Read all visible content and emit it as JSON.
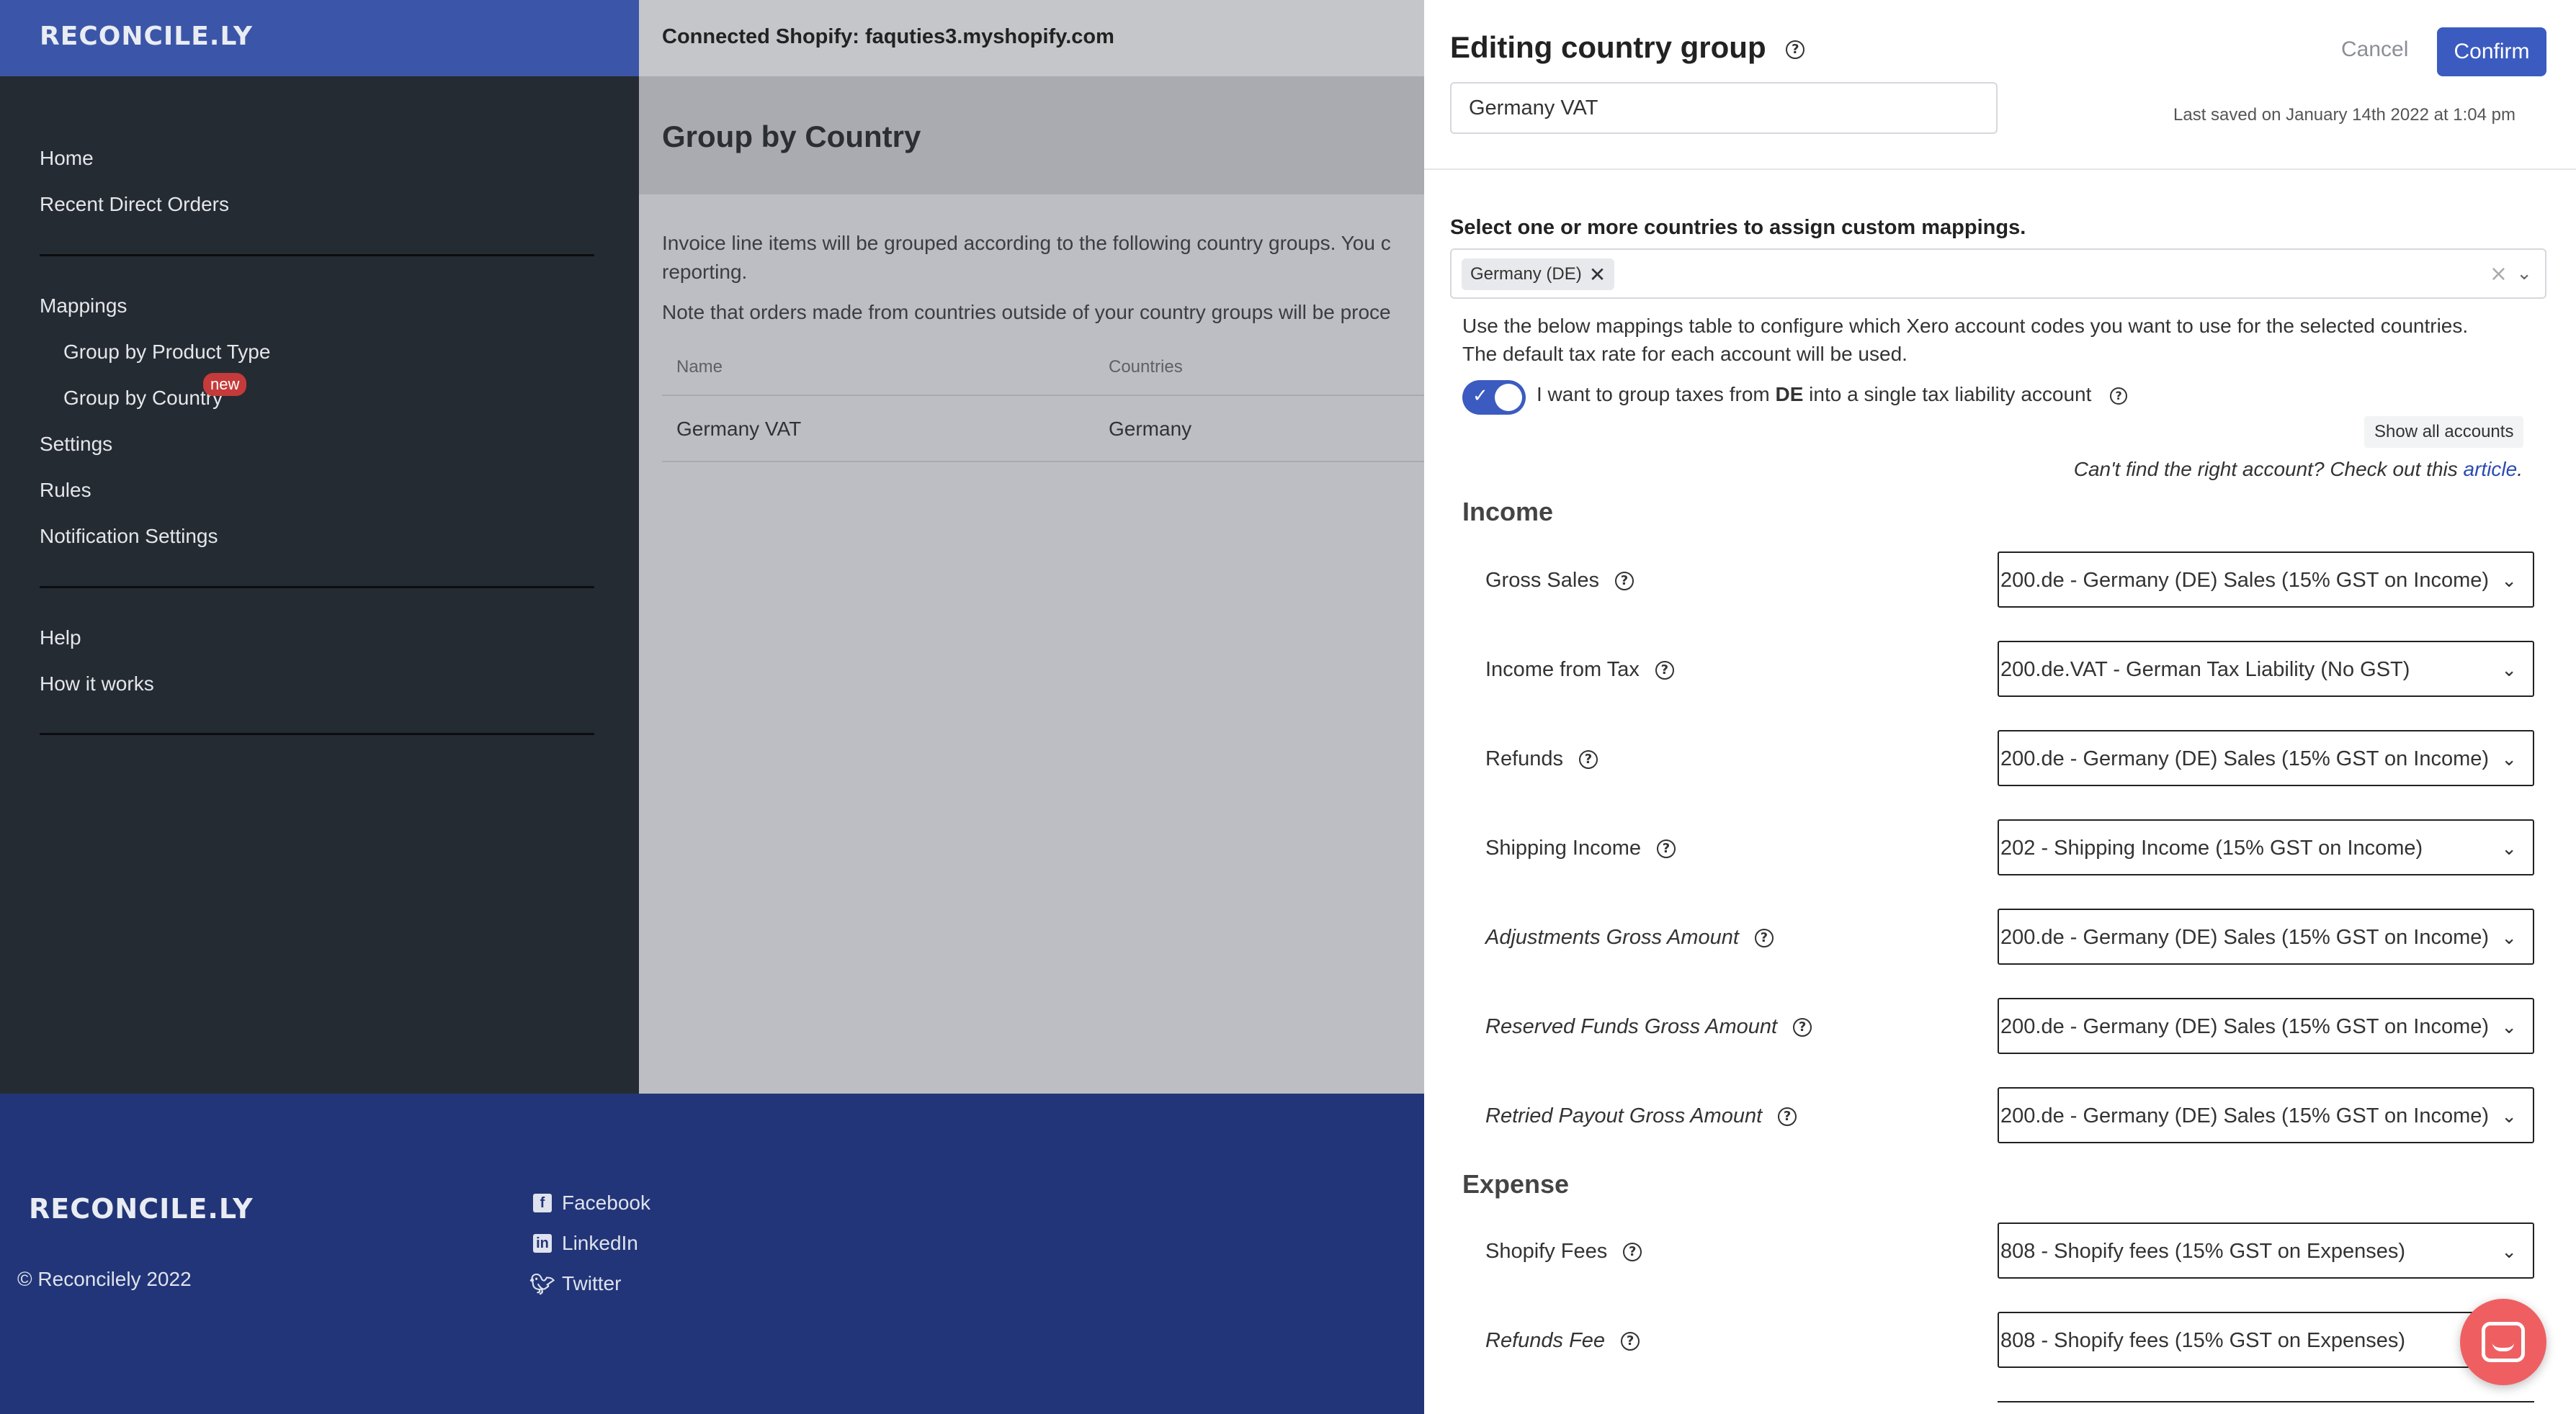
{
  "app": {
    "brand": "RECONCILE.LY"
  },
  "sidebar": {
    "items": [
      {
        "label": "Home"
      },
      {
        "label": "Recent Direct Orders"
      },
      {
        "label": "Mappings"
      },
      {
        "label": "Group by Product Type"
      },
      {
        "label": "Group by Country",
        "badge": "new"
      },
      {
        "label": "Settings"
      },
      {
        "label": "Rules"
      },
      {
        "label": "Notification Settings"
      },
      {
        "label": "Help"
      },
      {
        "label": "How it works"
      }
    ]
  },
  "main": {
    "connected": "Connected Shopify: faquties3.myshopify.com",
    "title": "Group by Country",
    "para1_line1": "Invoice line items will be grouped according to the following country groups. You c",
    "para1_line2": "reporting.",
    "para2": "Note that orders made from countries outside of your country groups will be proce",
    "table": {
      "headers": [
        "Name",
        "Countries"
      ],
      "rows": [
        [
          "Germany VAT",
          "Germany"
        ]
      ]
    }
  },
  "footer": {
    "brand": "RECONCILE.LY",
    "copyright": "© Reconcilely 2022",
    "links": [
      "Facebook",
      "LinkedIn",
      "Twitter"
    ]
  },
  "panel": {
    "title": "Editing country group",
    "cancel": "Cancel",
    "confirm": "Confirm",
    "name_value": "Germany VAT",
    "last_saved": "Last saved on January 14th 2022 at 1:04 pm",
    "select_label": "Select one or more countries to assign custom mappings.",
    "chip": "Germany (DE)",
    "desc_line1": "Use the below mappings table to configure which Xero account codes you want to use for the selected countries.",
    "desc_line2": "The default tax rate for each account will be used.",
    "toggle_pre": "I want to group taxes from ",
    "toggle_bold": "DE",
    "toggle_post": " into a single tax liability account",
    "toggle_on": true,
    "show_all": "Show all accounts",
    "help_text": "Can't find the right account? Check out this ",
    "help_link": "article",
    "help_end": ".",
    "income": {
      "heading": "Income",
      "rows": [
        {
          "label": "Gross Sales",
          "value": "200.de - Germany (DE) Sales (15% GST on Income)"
        },
        {
          "label": "Income from Tax",
          "value": "200.de.VAT - German Tax Liability (No GST)"
        },
        {
          "label": "Refunds",
          "value": "200.de - Germany (DE) Sales (15% GST on Income)"
        },
        {
          "label": "Shipping Income",
          "value": "202 - Shipping Income (15% GST on Income)"
        },
        {
          "label": "Adjustments Gross Amount",
          "value": "200.de - Germany (DE) Sales (15% GST on Income)"
        },
        {
          "label": "Reserved Funds Gross Amount",
          "value": "200.de - Germany (DE) Sales (15% GST on Income)"
        },
        {
          "label": "Retried Payout Gross Amount",
          "value": "200.de - Germany (DE) Sales (15% GST on Income)"
        }
      ]
    },
    "expense": {
      "heading": "Expense",
      "rows": [
        {
          "label": "Shopify Fees",
          "value": "808 - Shopify fees (15% GST on Expenses)"
        },
        {
          "label": "Refunds Fee",
          "value": "808 - Shopify fees (15% GST on Expenses)"
        }
      ]
    }
  },
  "colors": {
    "brand_blue": "#3b56a8",
    "footer_blue": "#223578",
    "accent": "#3b5bc0",
    "chat": "#ef5f62"
  }
}
